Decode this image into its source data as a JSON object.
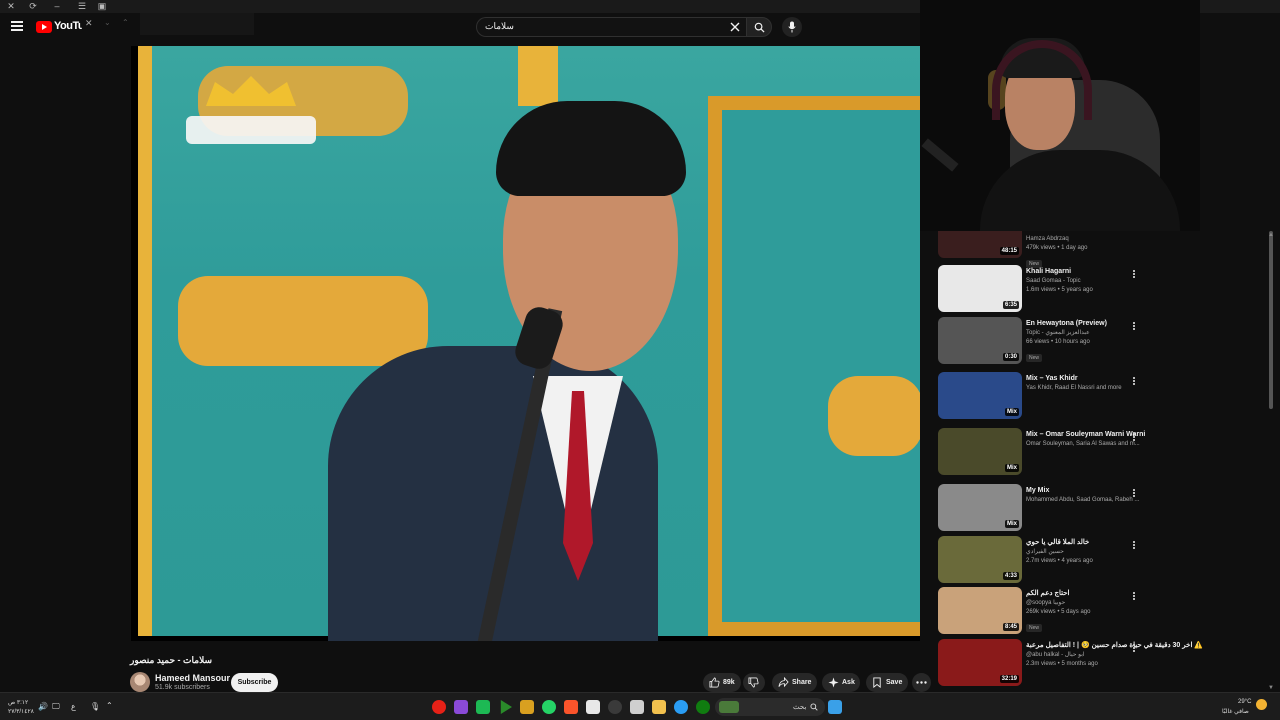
{
  "header": {
    "logo_text": "YouTube",
    "search_query": "سلامات"
  },
  "video": {
    "title": "سلامات - حميد منصور",
    "channel": "Hameed Mansour",
    "subscribers": "51.9k subscribers",
    "subscribe_label": "Subscribe",
    "likes": "89k",
    "share_label": "Share",
    "ask_label": "Ask",
    "save_label": "Save"
  },
  "recommendations": [
    {
      "title": "",
      "channel": "Hamza Abdrzaq",
      "stats": "479k views • 1 day ago",
      "duration": "48:15",
      "badge": "New",
      "thumb_color": "#3a1e1e"
    },
    {
      "title": "Khali Hagarni",
      "channel": "Saad Gomaa - Topic",
      "stats": "1.6m views • 5 years ago",
      "duration": "6:35",
      "badge": "",
      "thumb_color": "#e8e8e8"
    },
    {
      "title": "En Hewaytona (Preview)",
      "channel": "Topic - عبدالعزيز المعنوي",
      "stats": "66 views • 10 hours ago",
      "duration": "0:30",
      "badge": "New",
      "thumb_color": "#555555"
    },
    {
      "title": "Mix – Yas Khidr",
      "channel": "Yas Khidr, Raad El Nassri and more",
      "stats": "",
      "duration": "Mix",
      "badge": "",
      "thumb_color": "#2a4a8a"
    },
    {
      "title": "Mix – Omar Souleyman Warni Warni",
      "channel": "Omar Souleyman, Saria Al Sawas and m...",
      "stats": "",
      "duration": "Mix",
      "badge": "",
      "thumb_color": "#4a4a2a"
    },
    {
      "title": "My Mix",
      "channel": "Mohammed Abdu, Saad Gomaa, Rabeh ...",
      "stats": "",
      "duration": "Mix",
      "badge": "",
      "thumb_color": "#8a8a8a"
    },
    {
      "title": "خالد الملا قالي يا حوي",
      "channel": "حسين الفيرادي",
      "stats": "2.7m views • 4 years ago",
      "duration": "4:33",
      "badge": "",
      "thumb_color": "#6a6a3a"
    },
    {
      "title": "احتاج دعم الكم",
      "channel": "@soopya حوبيا",
      "stats": "269k views • 5 days ago",
      "duration": "8:45",
      "badge": "New",
      "thumb_color": "#c9a27a"
    },
    {
      "title": "اخر 30 دقيقة في حياة صدام حسين 🥺 | ! التفاصيل مرعبة ⚠️",
      "channel": "@abu halkal - ابو حيال",
      "stats": "2.3m views • 5 months ago",
      "duration": "32:19",
      "badge": "",
      "thumb_color": "#8a1a1a"
    }
  ],
  "taskbar": {
    "left_time": "٣:١٢ ص",
    "left_date": "٢٧/٣/١٤٢٨",
    "lang": "ع",
    "search_placeholder": "بحث",
    "weather_temp": "29°C",
    "weather_desc": "صافي غالبًا"
  },
  "colors": {
    "background": "#0f0f0f",
    "accent_red": "#ff0000",
    "text": "#f1f1f1",
    "muted": "#aaaaaa"
  }
}
